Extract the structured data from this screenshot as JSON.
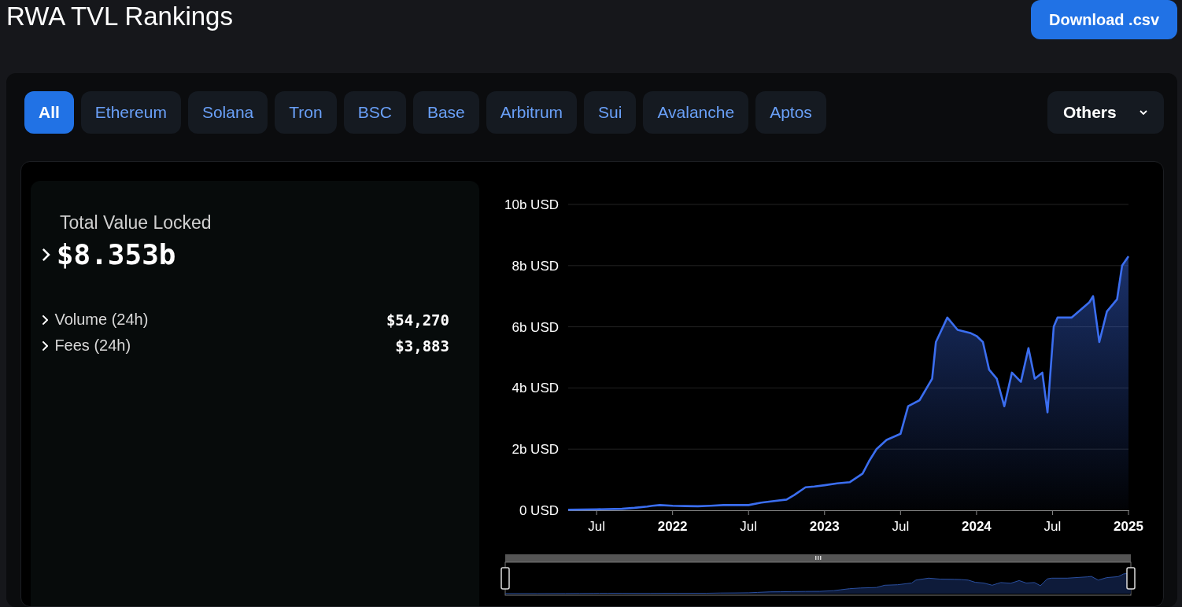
{
  "header": {
    "title": "RWA TVL Rankings",
    "download_button": "Download .csv"
  },
  "chain_tabs": [
    {
      "label": "All",
      "selected": true
    },
    {
      "label": "Ethereum",
      "selected": false
    },
    {
      "label": "Solana",
      "selected": false
    },
    {
      "label": "Tron",
      "selected": false
    },
    {
      "label": "BSC",
      "selected": false
    },
    {
      "label": "Base",
      "selected": false
    },
    {
      "label": "Arbitrum",
      "selected": false
    },
    {
      "label": "Sui",
      "selected": false
    },
    {
      "label": "Avalanche",
      "selected": false
    },
    {
      "label": "Aptos",
      "selected": false
    }
  ],
  "others_dropdown": {
    "label": "Others"
  },
  "summary": {
    "tvl_label": "Total Value Locked",
    "tvl_value": "$8.353b",
    "metrics": [
      {
        "label": "Volume (24h)",
        "value": "$54,270"
      },
      {
        "label": "Fees (24h)",
        "value": "$3,883"
      }
    ]
  },
  "chart": {
    "chart_data": {
      "type": "area",
      "grid": true,
      "xlim": [
        2021.313,
        2025
      ],
      "ylim": [
        0,
        10
      ],
      "x": [
        2021.313,
        2021.5,
        2021.667,
        2021.75,
        2021.833,
        2021.867,
        2021.917,
        2022,
        2022.083,
        2022.167,
        2022.25,
        2022.333,
        2022.417,
        2022.5,
        2022.583,
        2022.667,
        2022.75,
        2022.8,
        2022.875,
        2022.933,
        2023,
        2023.083,
        2023.167,
        2023.25,
        2023.292,
        2023.342,
        2023.408,
        2023.5,
        2023.55,
        2023.625,
        2023.708,
        2023.733,
        2023.808,
        2023.875,
        2023.958,
        2024,
        2024.042,
        2024.083,
        2024.133,
        2024.183,
        2024.233,
        2024.292,
        2024.342,
        2024.383,
        2024.433,
        2024.467,
        2024.508,
        2024.533,
        2024.625,
        2024.742,
        2024.767,
        2024.808,
        2024.858,
        2024.925,
        2024.958,
        2025
      ],
      "series": [
        {
          "color": "#3b6ef0",
          "values": [
            0.02,
            0.03,
            0.05,
            0.08,
            0.12,
            0.15,
            0.17,
            0.15,
            0.14,
            0.13,
            0.15,
            0.17,
            0.17,
            0.17,
            0.25,
            0.3,
            0.35,
            0.5,
            0.75,
            0.78,
            0.82,
            0.88,
            0.92,
            1.2,
            1.6,
            2.0,
            2.3,
            2.5,
            3.4,
            3.6,
            4.3,
            5.5,
            6.3,
            5.9,
            5.8,
            5.7,
            5.5,
            4.6,
            4.3,
            3.4,
            4.5,
            4.2,
            5.3,
            4.3,
            4.5,
            3.2,
            6.0,
            6.3,
            6.3,
            6.8,
            7.0,
            5.5,
            6.5,
            6.9,
            8.0,
            8.3
          ]
        }
      ],
      "xticks": [
        {
          "value": 2021.5,
          "label": "Jul"
        },
        2022,
        {
          "value": 2022.5,
          "label": "Jul"
        },
        2023,
        {
          "value": 2023.5,
          "label": "Jul"
        },
        2024,
        {
          "value": 2024.5,
          "label": "Jul"
        },
        2025
      ],
      "yticks": [
        {
          "value": 0,
          "label": "0 USD"
        },
        {
          "value": 2,
          "label": "2b USD"
        },
        {
          "value": 4,
          "label": "4b USD"
        },
        {
          "value": 6,
          "label": "6b USD"
        },
        {
          "value": 8,
          "label": "8b USD"
        },
        {
          "value": 10,
          "label": "10b USD"
        }
      ]
    }
  }
}
